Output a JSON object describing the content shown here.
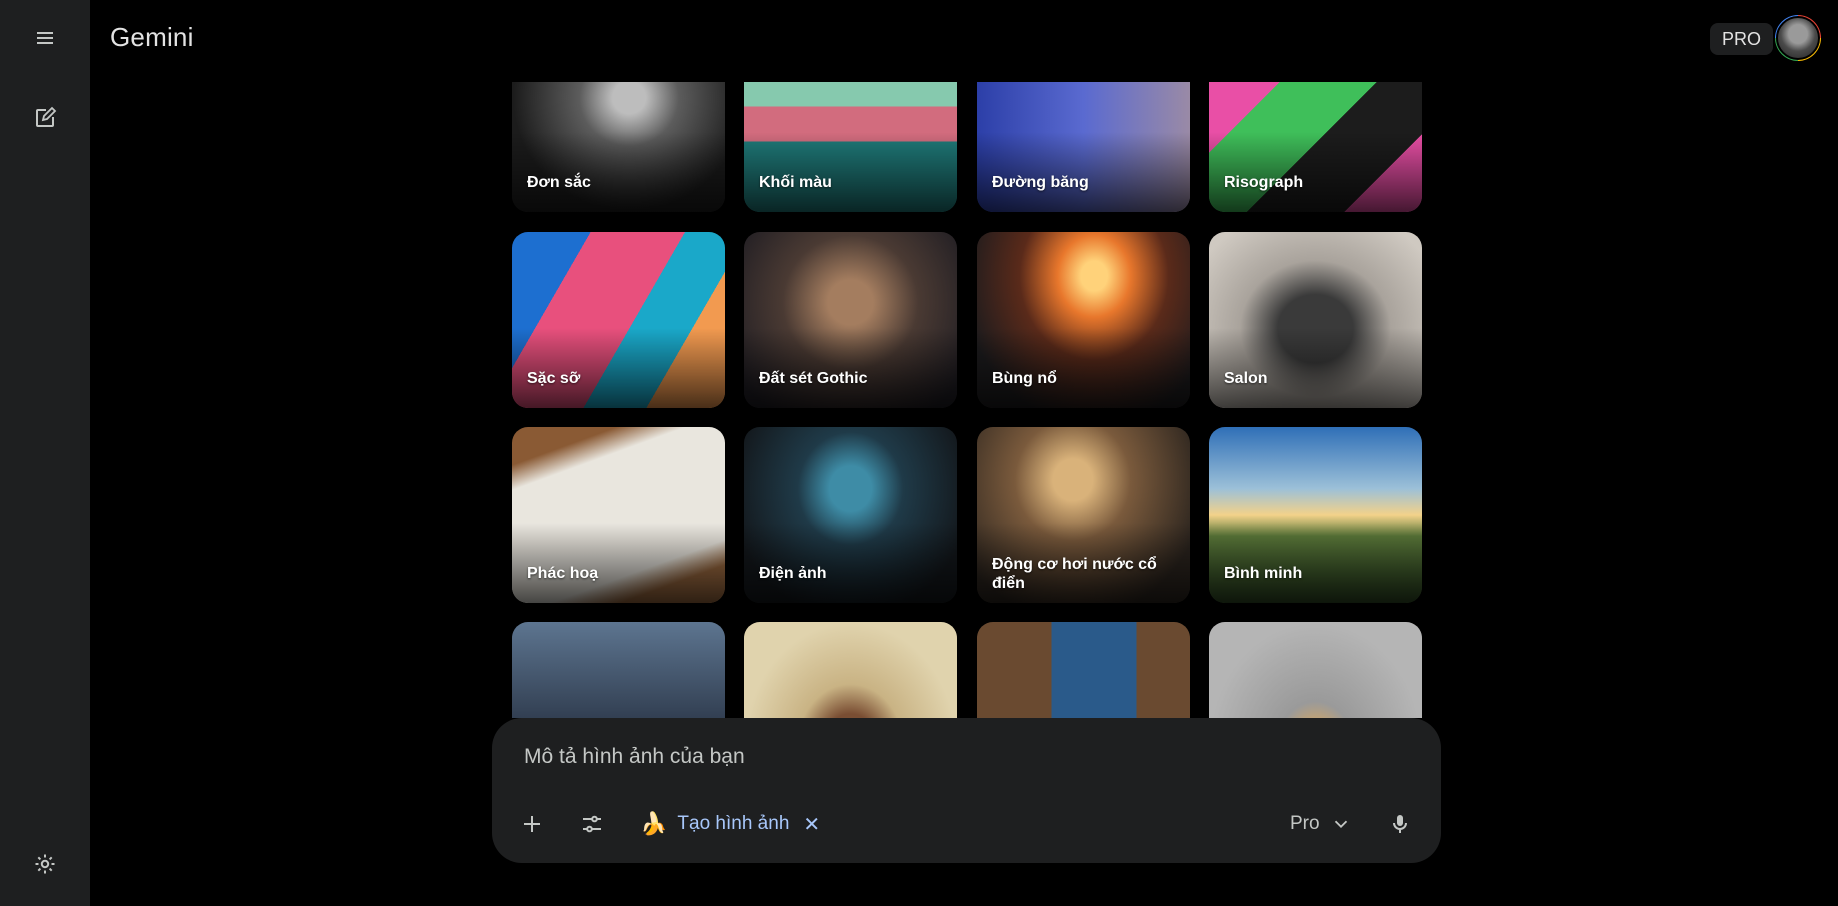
{
  "app": {
    "title": "Gemini",
    "plan_badge": "PRO"
  },
  "sidebar": {
    "icons": [
      "menu-icon",
      "new-chat-icon",
      "settings-icon"
    ]
  },
  "gallery": {
    "rows": [
      [
        "Đơn sắc",
        "Khối màu",
        "Đường băng",
        "Risograph"
      ],
      [
        "Sặc sỡ",
        "Đất sét Gothic",
        "Bùng nổ",
        "Salon"
      ],
      [
        "Phác hoạ",
        "Điện ảnh",
        "Động cơ hơi nước cổ điển",
        "Bình minh"
      ],
      [
        "",
        "",
        "",
        ""
      ]
    ]
  },
  "composer": {
    "placeholder": "Mô tả hình ảnh của bạn",
    "tool_chip": {
      "emoji": "🍌",
      "label": "Tạo hình ảnh",
      "close": "✕"
    },
    "model": "Pro"
  },
  "colors": {
    "background": "#000000",
    "surface": "#1e1f20",
    "accent": "#a8c7fa",
    "text": "#e3e3e3"
  }
}
